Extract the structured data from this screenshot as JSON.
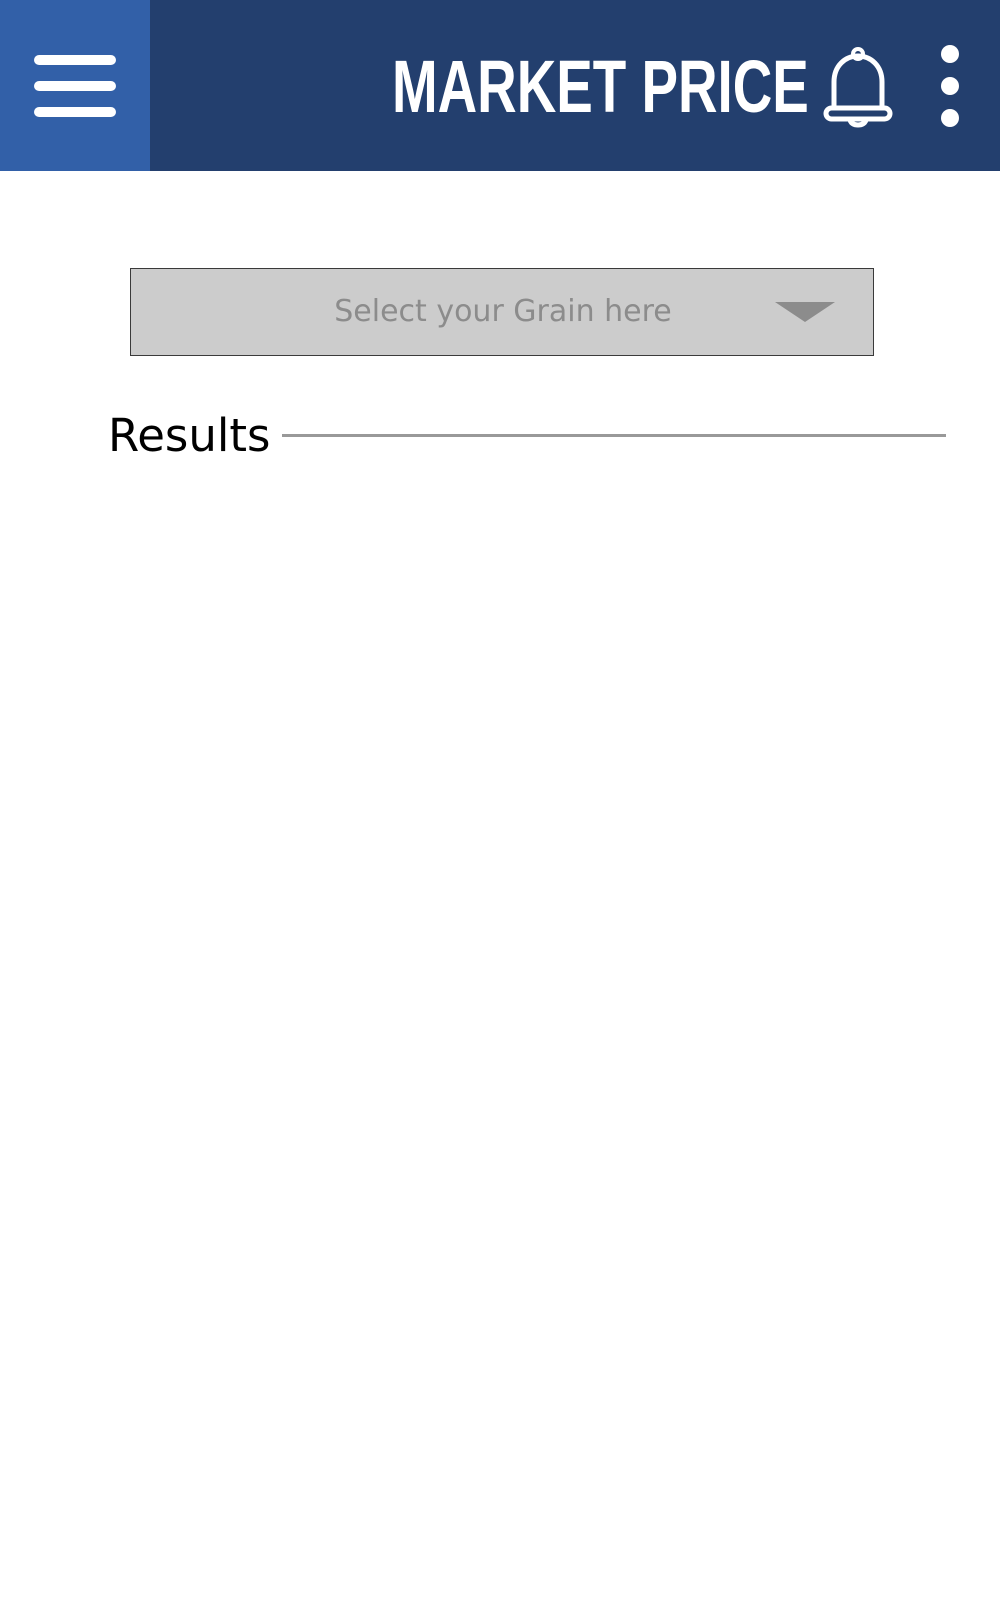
{
  "app_bar": {
    "title": "MARKET PRICE",
    "background_color": "#233f6e",
    "menu_background_color": "#3260a8",
    "menu_icon": "hamburger-menu-icon",
    "notification_icon": "bell-icon",
    "more_icon": "vertical-dots-icon"
  },
  "grain_select": {
    "placeholder": "Select your Grain here",
    "arrow_icon": "caret-down-icon"
  },
  "results": {
    "label": "Results"
  }
}
